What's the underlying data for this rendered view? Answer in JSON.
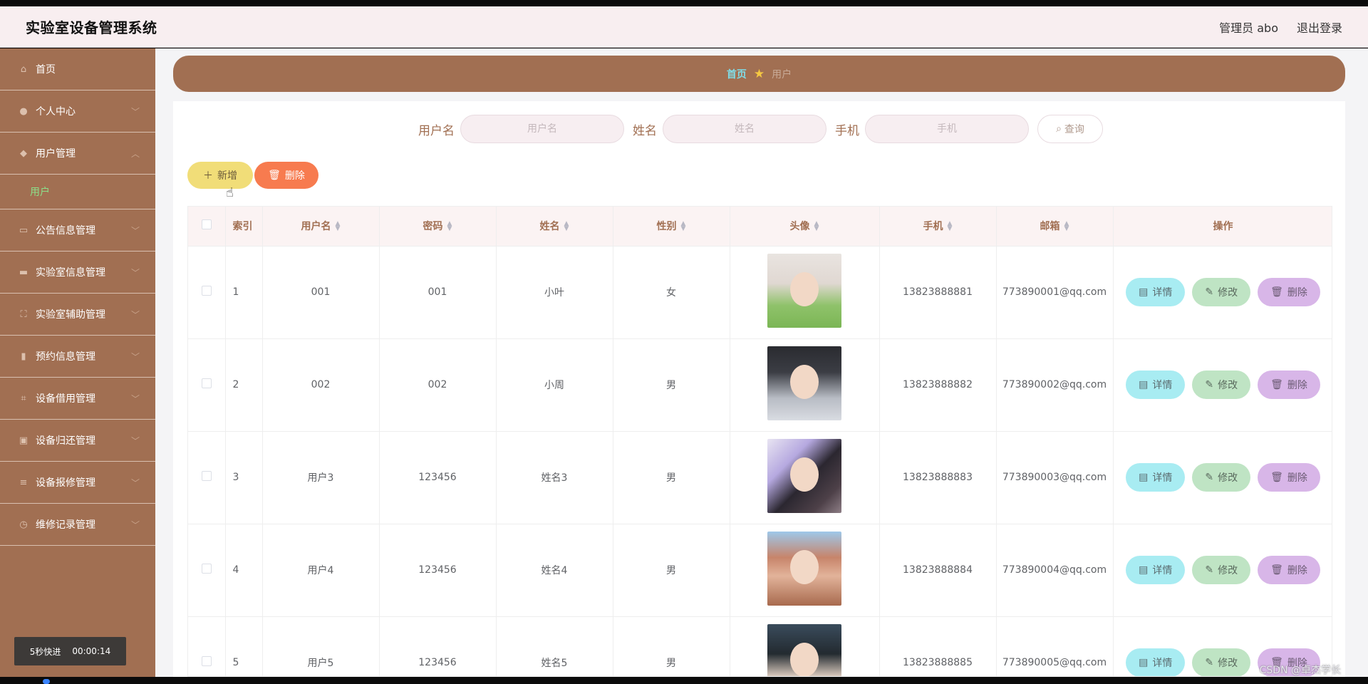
{
  "app": {
    "title": "实验室设备管理系统"
  },
  "header": {
    "admin": "管理员 abo",
    "logout": "退出登录"
  },
  "sidebar": {
    "items": [
      {
        "label": "首页",
        "icon": "home-icon",
        "expandable": false
      },
      {
        "label": "个人中心",
        "icon": "user-icon",
        "expandable": true
      },
      {
        "label": "用户管理",
        "icon": "pin-icon",
        "expandable": true,
        "expanded": true
      },
      {
        "label": "公告信息管理",
        "icon": "id-card-icon",
        "expandable": true
      },
      {
        "label": "实验室信息管理",
        "icon": "chat-icon",
        "expandable": true
      },
      {
        "label": "实验室辅助管理",
        "icon": "fullscreen-icon",
        "expandable": true
      },
      {
        "label": "预约信息管理",
        "icon": "mic-icon",
        "expandable": true
      },
      {
        "label": "设备借用管理",
        "icon": "crop-icon",
        "expandable": true
      },
      {
        "label": "设备归还管理",
        "icon": "briefcase-icon",
        "expandable": true
      },
      {
        "label": "设备报修管理",
        "icon": "list-icon",
        "expandable": true
      },
      {
        "label": "维修记录管理",
        "icon": "clock-icon",
        "expandable": true
      }
    ],
    "sub_active": "用户"
  },
  "breadcrumb": {
    "home": "首页",
    "current": "用户"
  },
  "search": {
    "username_label": "用户名",
    "username_placeholder": "用户名",
    "name_label": "姓名",
    "name_placeholder": "姓名",
    "phone_label": "手机",
    "phone_placeholder": "手机",
    "button": "查询"
  },
  "actions": {
    "add": "新增",
    "delete": "删除"
  },
  "table": {
    "headers": {
      "index": "索引",
      "username": "用户名",
      "password": "密码",
      "name": "姓名",
      "gender": "性别",
      "avatar": "头像",
      "phone": "手机",
      "email": "邮箱",
      "ops": "操作"
    },
    "ops_labels": {
      "detail": "详情",
      "edit": "修改",
      "delete": "删除"
    },
    "rows": [
      {
        "index": "1",
        "username": "001",
        "password": "001",
        "name": "小叶",
        "gender": "女",
        "phone": "13823888881",
        "email": "773890001@qq.com"
      },
      {
        "index": "2",
        "username": "002",
        "password": "002",
        "name": "小周",
        "gender": "男",
        "phone": "13823888882",
        "email": "773890002@qq.com"
      },
      {
        "index": "3",
        "username": "用户3",
        "password": "123456",
        "name": "姓名3",
        "gender": "男",
        "phone": "13823888883",
        "email": "773890003@qq.com"
      },
      {
        "index": "4",
        "username": "用户4",
        "password": "123456",
        "name": "姓名4",
        "gender": "男",
        "phone": "13823888884",
        "email": "773890004@qq.com"
      },
      {
        "index": "5",
        "username": "用户5",
        "password": "123456",
        "name": "姓名5",
        "gender": "男",
        "phone": "13823888885",
        "email": "773890005@qq.com"
      }
    ]
  },
  "overlay": {
    "speed": "5秒快进",
    "time": "00:00:14",
    "watermark": "CSDN @卓杰学长"
  },
  "colors": {
    "brand": "#a16f52",
    "header_bg": "#f8eef0",
    "accent_active": "#8ce08a"
  }
}
